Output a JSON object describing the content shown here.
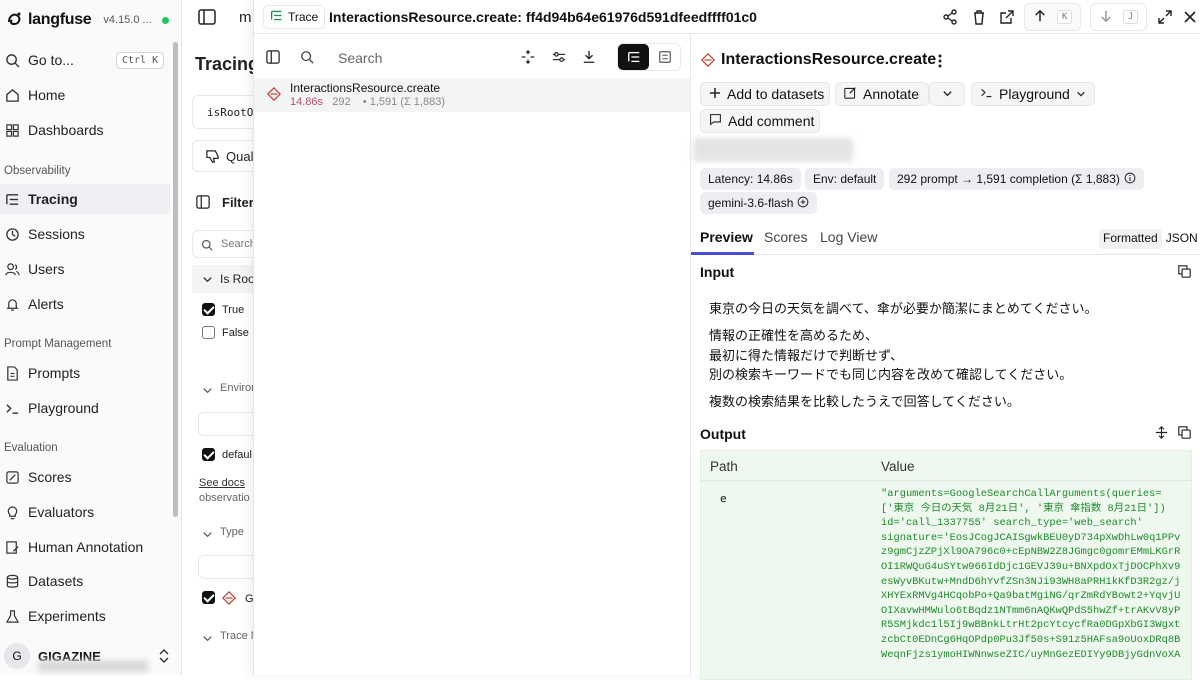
{
  "sidebar": {
    "brand": "langfuse",
    "version": "v4.15.0 ...",
    "goto": {
      "label": "Go to...",
      "shortcut": "Ctrl K"
    },
    "items_top": [
      {
        "label": "Home",
        "icon": "home-icon"
      },
      {
        "label": "Dashboards",
        "icon": "dashboard-icon"
      }
    ],
    "sections": {
      "observability": "Observability",
      "prompt_management": "Prompt Management",
      "evaluation": "Evaluation"
    },
    "observability_items": [
      {
        "label": "Tracing",
        "icon": "tracing-icon",
        "active": true
      },
      {
        "label": "Sessions",
        "icon": "clock-icon"
      },
      {
        "label": "Users",
        "icon": "users-icon"
      },
      {
        "label": "Alerts",
        "icon": "bell-icon"
      }
    ],
    "prompt_items": [
      {
        "label": "Prompts",
        "icon": "file-icon"
      },
      {
        "label": "Playground",
        "icon": "terminal-icon"
      }
    ],
    "evaluation_items": [
      {
        "label": "Scores",
        "icon": "score-icon"
      },
      {
        "label": "Evaluators",
        "icon": "lightbulb-icon"
      },
      {
        "label": "Human Annotation",
        "icon": "annotation-icon"
      },
      {
        "label": "Datasets",
        "icon": "database-icon"
      },
      {
        "label": "Experiments",
        "icon": "flask-icon"
      }
    ],
    "org": {
      "initial": "G",
      "name": "GIGAZINE"
    }
  },
  "filtercol": {
    "page_title": "Tracing",
    "breadcrumb_partial": "m",
    "filter_chip": "isRootOb",
    "quality_btn": "Qual",
    "filters_label": "Filter",
    "search_placeholder": "Search",
    "is_root_label": "Is Root",
    "true_label": "True",
    "false_label": "False",
    "env_label": "Environ",
    "default_label": "defaul",
    "docs_link": "See docs",
    "docs_rest": "observatio",
    "type_label": "Type",
    "g_label": "G",
    "trace_name_label": "Trace N"
  },
  "topbar": {
    "pill_label": "Trace",
    "title": "InteractionsResource.create: ff4d94b64e61976d591dfeedffff01c0",
    "prev_key": "K",
    "next_key": "J"
  },
  "tree": {
    "search_placeholder": "Search",
    "row": {
      "name": "InteractionsResource.create",
      "latency": "14.86s",
      "tokens": "292",
      "totals": "• 1,591 (Σ 1,883)"
    }
  },
  "detail": {
    "title": "InteractionsResource.create",
    "add_to_datasets": "Add to datasets",
    "annotate": "Annotate",
    "playground": "Playground",
    "add_comment": "Add comment",
    "badges": {
      "latency": "Latency: 14.86s",
      "env": "Env: default",
      "tokens": "292 prompt → 1,591 completion (Σ 1,883)",
      "model": "gemini-3.6-flash"
    },
    "tabs": [
      "Preview",
      "Scores",
      "Log View"
    ],
    "format": {
      "formatted": "Formatted",
      "json": "JSON"
    },
    "input_label": "Input",
    "input_lines": [
      "東京の今日の天気を調べて、傘が必要か簡潔にまとめてください。",
      "情報の正確性を高めるため、",
      "最初に得た情報だけで判断せず、",
      "別の検索キーワードでも同じ内容を改めて確認してください。",
      "複数の検索結果を比較したうえで回答してください。"
    ],
    "output_label": "Output",
    "output_headers": {
      "path": "Path",
      "value": "Value"
    },
    "output_key": "e",
    "output_value": "\"arguments=GoogleSearchCallArguments(queries=\n['東京 今日の天気 8月21日', '東京 傘指数 8月21日'])\nid='call_1337755' search_type='web_search'\nsignature='EosJCogJCAISgwkBEU0yD734pXwDhLw0q1PPv\nz9gmCjzZPjXl9OA796c0+cEpNBW2Z8JGmgc0gomrEMmLKGrR\nOI1RWQuG4uSYtw966IdDjc1GEVJ39u+BNXpdOxTjDOCPhXv9\nesWyvBKutw+MndD6hYvfZSn3NJi93WH8aPRH1kKfD3R2gz/j\nXHYExRMVg4HCqobPo+Qa9batMgiNG/qrZmRdYBowt2+YqvjU\nOIXavwHMWulo6tBqdz1NTmm6nAQKwQPdS5hwZf+trAKvV8yP\nR5SMjkdc1l5Ij9wBBnkLtrHt2pcYtcycfRa0DGpXbGI3Wgxt\nzcbCt0EDnCg6HqOPdp0Pu3Jf50s+S91z5HAFsa9oUoxDRq8B\nWeqnFjzs1ymoHIWNnwseZIC/uyMnGezEDIYy9DBjyGdnVoXA"
  }
}
